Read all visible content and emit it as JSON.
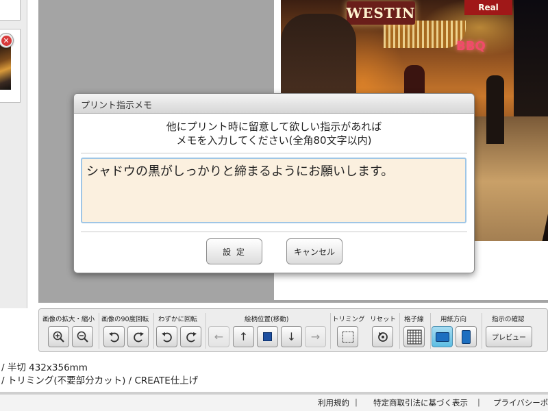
{
  "dialog": {
    "title": "プリント指示メモ",
    "message_line1": "他にプリント時に留意して欲しい指示があれば",
    "message_line2": "メモを入力してください(全角80文字以内)",
    "memo_value": "シャドウの黒がしっかりと締まるようにお願いします。",
    "ok_label": "設 定",
    "cancel_label": "キャンセル"
  },
  "photo": {
    "sign_text": "WESTIN",
    "sign2_text": "Real",
    "bbq_text": "BBQ"
  },
  "toolbar": {
    "zoom_label": "画像の拡大・縮小",
    "rotate90_label": "画像の90度回転",
    "rotate_fine_label": "わずかに回転",
    "move_label": "絵柄位置(移動)",
    "trim_label": "トリミング",
    "reset_label": "リセット",
    "grid_label": "格子線",
    "orientation_label": "用紙方向",
    "confirm_label": "指示の確認",
    "preview_label": "プレビュー",
    "icons": [
      "zoom-in-icon",
      "zoom-out-icon",
      "rotate-left-icon",
      "rotate-right-icon",
      "rotate-fine-left-icon",
      "rotate-fine-right-icon",
      "arrow-left-icon",
      "arrow-up-icon",
      "center-square-icon",
      "arrow-down-icon",
      "arrow-right-icon",
      "trim-icon",
      "reset-icon",
      "grid-icon",
      "landscape-icon",
      "portrait-icon"
    ],
    "selected_color": "#5cbde3"
  },
  "info": {
    "line1": "/ 半切 432x356mm",
    "line2": "/ トリミング(不要部分カット) / CREATE仕上げ"
  },
  "footer": {
    "terms": "利用規約",
    "commerce": "特定商取引法に基づく表示",
    "privacy": "プライバシーポ"
  }
}
